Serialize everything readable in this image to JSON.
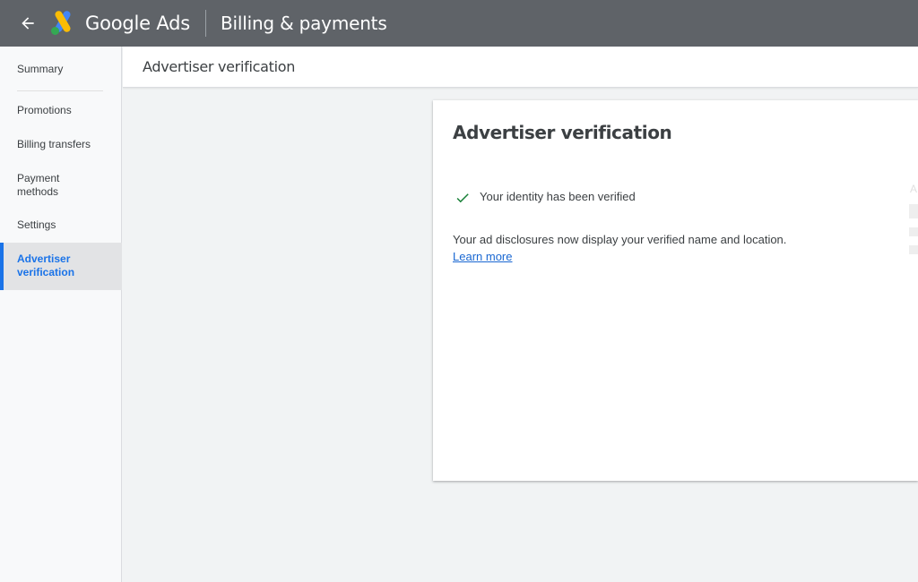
{
  "topbar": {
    "product_name": "Google Ads",
    "section_title": "Billing & payments",
    "logo_colors": [
      "#fbbc04",
      "#4285f4",
      "#34a853"
    ]
  },
  "sidebar": {
    "items": [
      {
        "label": "Summary"
      },
      {
        "label": "Promotions"
      },
      {
        "label": "Billing transfers"
      },
      {
        "label": "Payment methods"
      },
      {
        "label": "Settings"
      },
      {
        "label": "Advertiser verification",
        "active": true
      }
    ]
  },
  "page_header": {
    "title": "Advertiser verification"
  },
  "card": {
    "title": "Advertiser verification",
    "status_text": "Your identity has been verified",
    "status_icon": "check-icon",
    "description": "Your ad disclosures now display your verified name and location.",
    "learn_more": "Learn more",
    "truncated_letter": "A"
  },
  "colors": {
    "accent": "#1a73e8",
    "check": "#188038",
    "topbar": "#5f6368"
  }
}
